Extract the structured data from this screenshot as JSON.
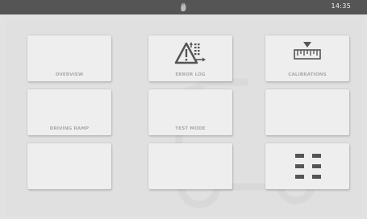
{
  "status_bar": {
    "logo_icon": "hand-logo-icon",
    "time": "14:35"
  },
  "tiles": [
    {
      "label": "OVERVIEW",
      "icon": null
    },
    {
      "label": "ERROR LOG",
      "icon": "warning-list-icon"
    },
    {
      "label": "CALIBRATIONS",
      "icon": "ruler-marker-icon"
    },
    {
      "label": "DRIVING RAMP",
      "icon": null
    },
    {
      "label": "TEST MODE",
      "icon": null
    },
    {
      "label": "",
      "icon": null
    },
    {
      "label": "",
      "icon": null
    },
    {
      "label": "",
      "icon": null
    },
    {
      "label": "",
      "icon": "grid-menu-icon"
    }
  ],
  "colors": {
    "status_bar": "#555555",
    "background": "#e2e2e2",
    "tile": "#eeeeee",
    "label": "#a8a8a8",
    "icon": "#555555"
  }
}
